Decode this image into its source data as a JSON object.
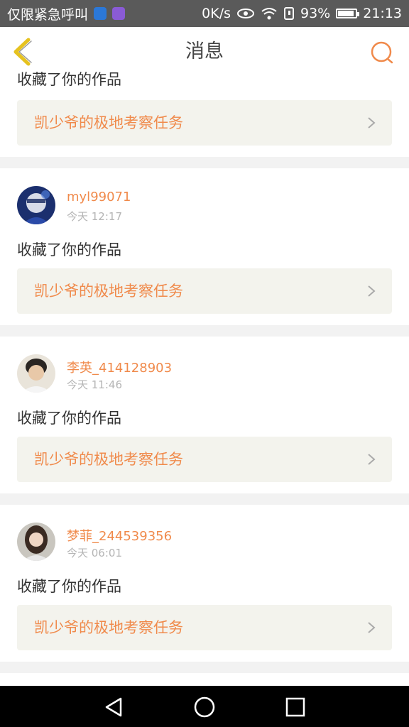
{
  "status_bar": {
    "carrier": "仅限紧急呼叫",
    "speed": "0K/s",
    "battery": "93%",
    "battery_level": 0.93,
    "time": "21:13"
  },
  "header": {
    "title": "消息"
  },
  "partial_item": {
    "action": "收藏了你的作品",
    "task": "凯少爷的极地考察任务"
  },
  "messages": [
    {
      "user": "myl99071",
      "time": "今天 12:17",
      "action": "收藏了你的作品",
      "task": "凯少爷的极地考察任务"
    },
    {
      "user": "李英_414128903",
      "time": "今天 11:46",
      "action": "收藏了你的作品",
      "task": "凯少爷的极地考察任务"
    },
    {
      "user": "梦菲_244539356",
      "time": "今天 06:01",
      "action": "收藏了你的作品",
      "task": "凯少爷的极地考察任务"
    }
  ],
  "colors": {
    "accent": "#f08a4b",
    "task_bg": "#f3f3ed",
    "back_icon": "#e6c21f"
  }
}
